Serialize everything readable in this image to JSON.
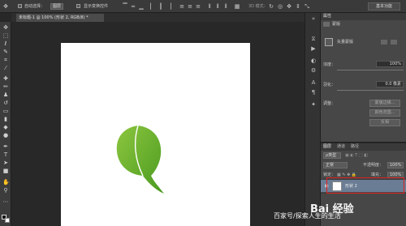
{
  "options_bar": {
    "auto_select_label": "自动选择：",
    "auto_select_value": "图层",
    "show_transform_label": "显示变换控件",
    "mode_3d_label": "3D 模式：",
    "workspace_label": "基本功能"
  },
  "document_tab": {
    "title": "未标题-1 @ 100% (形状 2, RGB/8) *"
  },
  "properties_panel": {
    "title": "属性",
    "mask_label": "蒙版",
    "vector_mask_label": "矢量蒙版",
    "density_label": "浓度：",
    "density_value": "100%",
    "feather_label": "羽化：",
    "feather_value": "0.0 像素",
    "refine_label": "调整：",
    "mask_edge_button": "蒙版边缘...",
    "color_range_button": "颜色范围...",
    "invert_button": "反相"
  },
  "layers_panel": {
    "tabs": [
      "图层",
      "通道",
      "路径"
    ],
    "kind_filter": "ρ类型",
    "blend_mode": "正常",
    "opacity_label": "不透明度：",
    "opacity_value": "100%",
    "lock_label": "锁定：",
    "fill_label": "填充：",
    "fill_value": "100%",
    "layers": [
      {
        "name": "形状 2",
        "selected": true
      }
    ]
  },
  "watermark": {
    "logo_text": "Bai 经验",
    "caption": "百家号/探索人生的生活"
  },
  "colors": {
    "ui_dark": "#282828",
    "panel": "#474747",
    "leaf_light": "#8cc63f",
    "leaf_dark": "#4a9a1f",
    "selection_highlight": "#e02020"
  }
}
